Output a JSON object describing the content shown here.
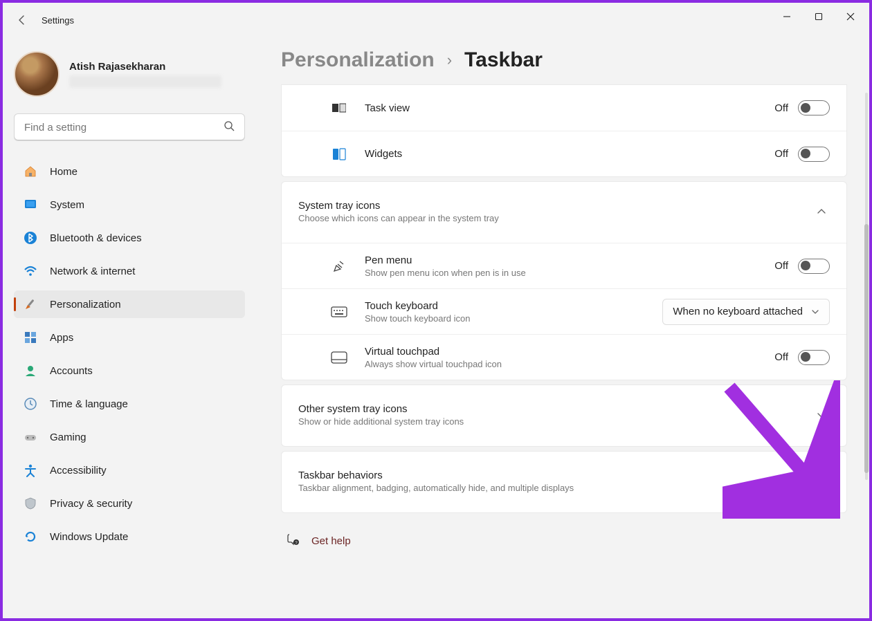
{
  "app_title": "Settings",
  "window_controls": {
    "min": "minimize",
    "max": "maximize",
    "close": "close"
  },
  "user": {
    "name": "Atish Rajasekharan"
  },
  "search": {
    "placeholder": "Find a setting"
  },
  "nav": [
    {
      "id": "home",
      "label": "Home"
    },
    {
      "id": "system",
      "label": "System"
    },
    {
      "id": "bluetooth",
      "label": "Bluetooth & devices"
    },
    {
      "id": "network",
      "label": "Network & internet"
    },
    {
      "id": "personalization",
      "label": "Personalization",
      "active": true
    },
    {
      "id": "apps",
      "label": "Apps"
    },
    {
      "id": "accounts",
      "label": "Accounts"
    },
    {
      "id": "time",
      "label": "Time & language"
    },
    {
      "id": "gaming",
      "label": "Gaming"
    },
    {
      "id": "accessibility",
      "label": "Accessibility"
    },
    {
      "id": "privacy",
      "label": "Privacy & security"
    },
    {
      "id": "update",
      "label": "Windows Update"
    }
  ],
  "breadcrumb": {
    "parent": "Personalization",
    "current": "Taskbar"
  },
  "toggle_labels": {
    "off": "Off"
  },
  "taskbar_items": {
    "task_view": {
      "label": "Task view",
      "state": "Off"
    },
    "widgets": {
      "label": "Widgets",
      "state": "Off"
    }
  },
  "system_tray": {
    "title": "System tray icons",
    "desc": "Choose which icons can appear in the system tray",
    "pen": {
      "label": "Pen menu",
      "desc": "Show pen menu icon when pen is in use",
      "state": "Off"
    },
    "touch": {
      "label": "Touch keyboard",
      "desc": "Show touch keyboard icon",
      "dropdown": "When no keyboard attached"
    },
    "vtouch": {
      "label": "Virtual touchpad",
      "desc": "Always show virtual touchpad icon",
      "state": "Off"
    }
  },
  "other_tray": {
    "title": "Other system tray icons",
    "desc": "Show or hide additional system tray icons"
  },
  "behaviors": {
    "title": "Taskbar behaviors",
    "desc": "Taskbar alignment, badging, automatically hide, and multiple displays"
  },
  "help": {
    "label": "Get help"
  }
}
